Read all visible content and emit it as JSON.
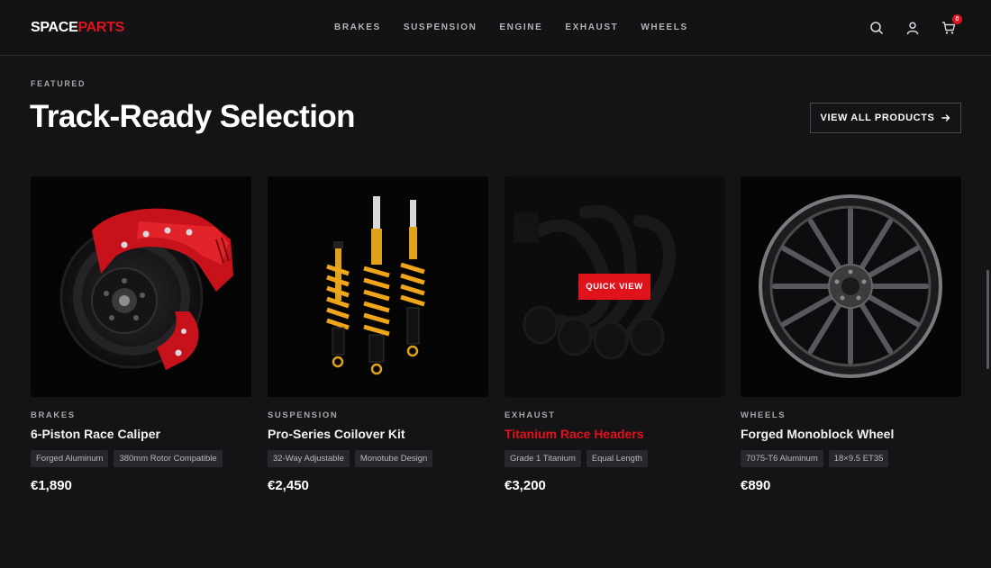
{
  "brand": {
    "part1": "SPACE",
    "part2": "PARTS"
  },
  "nav": [
    "BRAKES",
    "SUSPENSION",
    "ENGINE",
    "EXHAUST",
    "WHEELS"
  ],
  "header_icons": {
    "search": "search-icon",
    "account": "user-icon",
    "cart": "cart-icon",
    "cart_count": "0"
  },
  "section": {
    "eyebrow": "FEATURED",
    "title": "Track-Ready Selection",
    "view_all": "VIEW ALL PRODUCTS"
  },
  "products": [
    {
      "category": "BRAKES",
      "name": "6-Piston Race Caliper",
      "tags": [
        "Forged Aluminum",
        "380mm Rotor Compatible"
      ],
      "price": "€1,890"
    },
    {
      "category": "SUSPENSION",
      "name": "Pro-Series Coilover Kit",
      "tags": [
        "32-Way Adjustable",
        "Monotube Design"
      ],
      "price": "€2,450"
    },
    {
      "category": "EXHAUST",
      "name": "Titanium Race Headers",
      "tags": [
        "Grade 1 Titanium",
        "Equal Length"
      ],
      "price": "€3,200",
      "quick_view": "QUICK VIEW"
    },
    {
      "category": "WHEELS",
      "name": "Forged Monoblock Wheel",
      "tags": [
        "7075-T6 Aluminum",
        "18×9.5 ET35"
      ],
      "price": "€890"
    }
  ],
  "colors": {
    "accent": "#e0131c",
    "background": "#141315",
    "tag_bg": "#29272b"
  }
}
